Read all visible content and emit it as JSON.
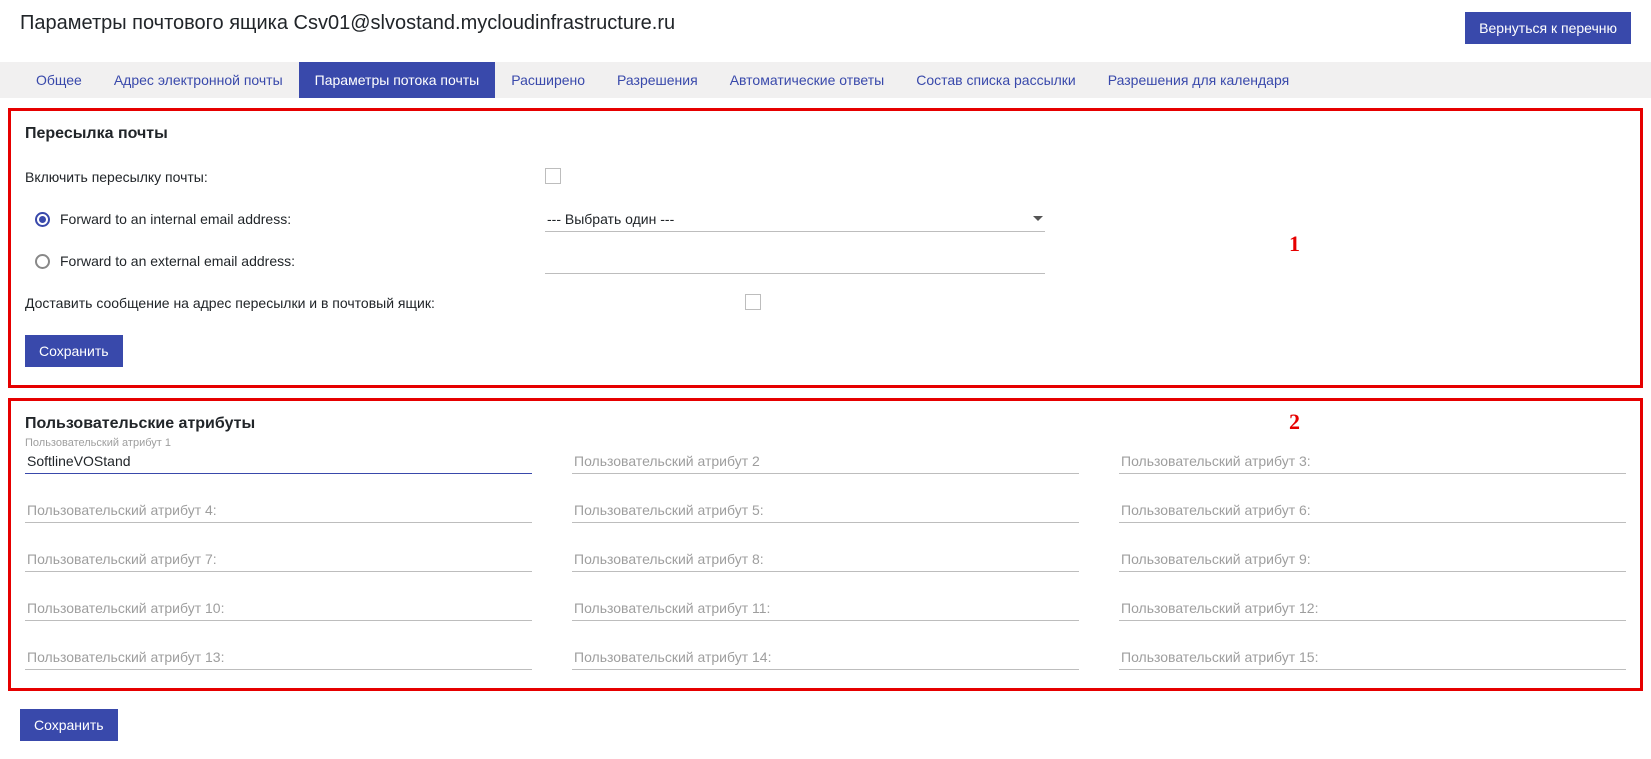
{
  "header": {
    "title": "Параметры почтового ящика Csv01@slvostand.mycloudinfrastructure.ru",
    "return_btn": "Вернуться к перечню"
  },
  "tabs": [
    "Общее",
    "Адрес электронной почты",
    "Параметры потока почты",
    "Расширено",
    "Разрешения",
    "Автоматические ответы",
    "Состав списка рассылки",
    "Разрешения для календаря"
  ],
  "active_tab_index": 2,
  "section1": {
    "annotation": "1",
    "title": "Пересылка почты",
    "enable_label": "Включить пересылку почты:",
    "radio_internal": "Forward to an internal email address:",
    "radio_external": "Forward to an external email address:",
    "select_placeholder": "--- Выбрать один ---",
    "deliver_label": "Доставить сообщение на адрес пересылки и в почтовый ящик:",
    "save": "Сохранить"
  },
  "section2": {
    "annotation": "2",
    "title": "Пользовательские атрибуты",
    "attr1_label": "Пользовательский атрибут 1",
    "attr1_value": "SoftlineVOStand",
    "placeholders": {
      "a2": "Пользовательский атрибут 2",
      "a3": "Пользовательский атрибут 3:",
      "a4": "Пользовательский атрибут 4:",
      "a5": "Пользовательский атрибут 5:",
      "a6": "Пользовательский атрибут 6:",
      "a7": "Пользовательский атрибут 7:",
      "a8": "Пользовательский атрибут 8:",
      "a9": "Пользовательский атрибут 9:",
      "a10": "Пользовательский атрибут 10:",
      "a11": "Пользовательский атрибут 11:",
      "a12": "Пользовательский атрибут 12:",
      "a13": "Пользовательский атрибут 13:",
      "a14": "Пользовательский атрибут 14:",
      "a15": "Пользовательский атрибут 15:"
    }
  },
  "footer": {
    "save": "Сохранить"
  }
}
